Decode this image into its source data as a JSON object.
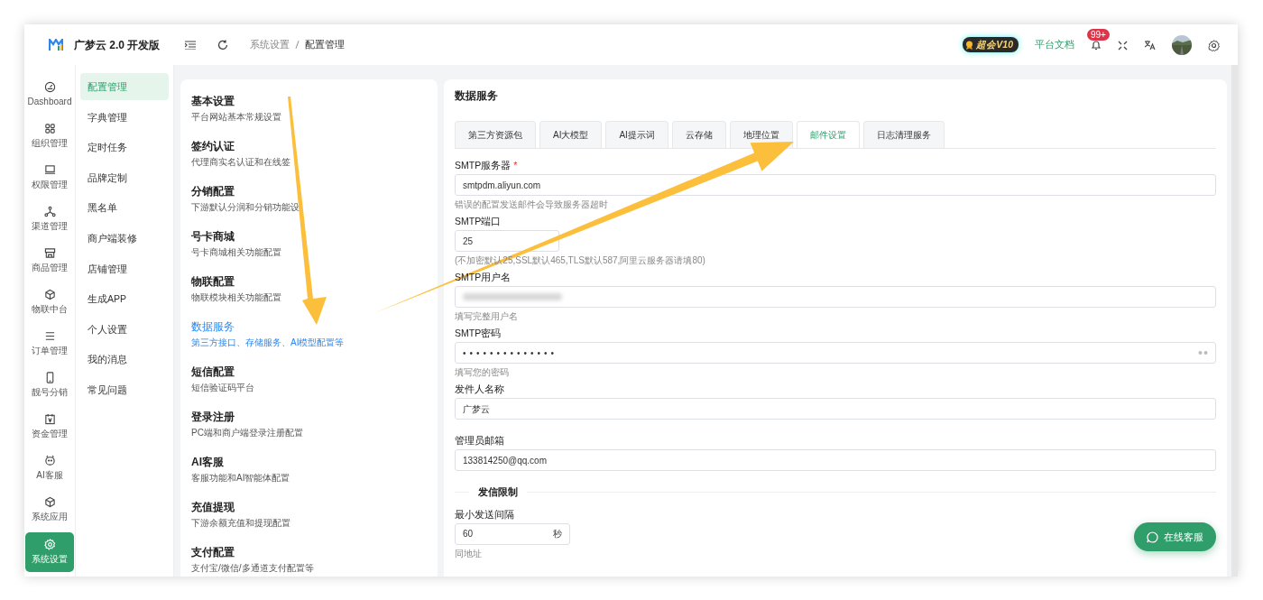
{
  "app": {
    "title": "广梦云 2.0 开发版"
  },
  "header": {
    "breadcrumb": [
      "系统设置",
      "配置管理"
    ],
    "vip_badge": "超会V10",
    "docs_link": "平台文档",
    "notification_count": "99+"
  },
  "rail": [
    {
      "label": "Dashboard",
      "selected": false
    },
    {
      "label": "组织管理",
      "selected": false
    },
    {
      "label": "权限管理",
      "selected": false
    },
    {
      "label": "渠道管理",
      "selected": false
    },
    {
      "label": "商品管理",
      "selected": false
    },
    {
      "label": "物联中台",
      "selected": false
    },
    {
      "label": "订单管理",
      "selected": false
    },
    {
      "label": "靓号分销",
      "selected": false
    },
    {
      "label": "资金管理",
      "selected": false
    },
    {
      "label": "AI客服",
      "selected": false
    },
    {
      "label": "系统应用",
      "selected": false
    },
    {
      "label": "系统设置",
      "selected": true
    }
  ],
  "submenu": [
    {
      "label": "配置管理",
      "selected": true
    },
    {
      "label": "字典管理",
      "selected": false
    },
    {
      "label": "定时任务",
      "selected": false
    },
    {
      "label": "品牌定制",
      "selected": false
    },
    {
      "label": "黑名单",
      "selected": false
    },
    {
      "label": "商户端装修",
      "selected": false
    },
    {
      "label": "店铺管理",
      "selected": false
    },
    {
      "label": "生成APP",
      "selected": false
    },
    {
      "label": "个人设置",
      "selected": false
    },
    {
      "label": "我的消息",
      "selected": false
    },
    {
      "label": "常见问题",
      "selected": false
    }
  ],
  "config_list": [
    {
      "title": "基本设置",
      "description": "平台网站基本常规设置",
      "selected": false
    },
    {
      "title": "签约认证",
      "description": "代理商实名认证和在线签",
      "selected": false
    },
    {
      "title": "分销配置",
      "description": "下游默认分润和分销功能设",
      "selected": false
    },
    {
      "title": "号卡商城",
      "description": "号卡商城相关功能配置",
      "selected": false
    },
    {
      "title": "物联配置",
      "description": "物联模块相关功能配置",
      "selected": false
    },
    {
      "title": "数据服务",
      "description": "第三方接口、存储服务、AI模型配置等",
      "selected": true
    },
    {
      "title": "短信配置",
      "description": "短信验证码平台",
      "selected": false
    },
    {
      "title": "登录注册",
      "description": "PC端和商户端登录注册配置",
      "selected": false
    },
    {
      "title": "AI客服",
      "description": "客服功能和AI智能体配置",
      "selected": false
    },
    {
      "title": "充值提现",
      "description": "下游余额充值和提现配置",
      "selected": false
    },
    {
      "title": "支付配置",
      "description": "支付宝/微信/多通道支付配置等",
      "selected": false
    }
  ],
  "panel": {
    "title": "数据服务",
    "tabs": [
      {
        "label": "第三方资源包",
        "selected": false
      },
      {
        "label": "AI大模型",
        "selected": false
      },
      {
        "label": "AI提示词",
        "selected": false
      },
      {
        "label": "云存储",
        "selected": false
      },
      {
        "label": "地理位置",
        "selected": false
      },
      {
        "label": "邮件设置",
        "selected": true
      },
      {
        "label": "日志清理服务",
        "selected": false
      }
    ],
    "fields": [
      {
        "kind": "text",
        "label": "SMTP服务器",
        "required_mark": "*",
        "value": "smtpdm.aliyun.com",
        "hint": "错误的配置发送邮件会导致服务器超时"
      },
      {
        "kind": "short",
        "label": "SMTP端口",
        "value": "25",
        "hint": "(不加密默认25,SSL默认465,TLS默认587,阿里云服务器请填80)"
      },
      {
        "kind": "blurred",
        "label": "SMTP用户名",
        "hint": "填写完整用户名"
      },
      {
        "kind": "password",
        "label": "SMTP密码",
        "value": "••••••••••••••",
        "hint": "填写您的密码"
      },
      {
        "kind": "text",
        "label": "发件人名称",
        "value": "广梦云"
      },
      {
        "kind": "text",
        "label": "管理员邮箱",
        "value": "133814250@qq.com"
      },
      {
        "kind": "section",
        "label": "发信限制"
      },
      {
        "kind": "suffix",
        "label": "最小发送间隔",
        "value": "60",
        "suffix": "秒",
        "hint": "同地址"
      }
    ]
  },
  "chat_button": {
    "label": "在线客服"
  }
}
